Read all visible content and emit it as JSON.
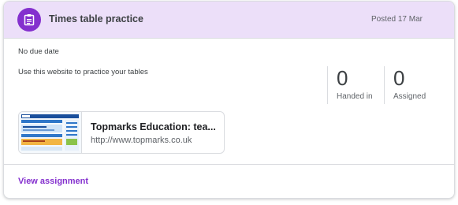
{
  "assignment": {
    "title": "Times table practice",
    "posted": "Posted 17 Mar",
    "due": "No due date",
    "instructions": "Use this website to practice your tables",
    "icon": "assignment-icon",
    "accent_color": "#8430ce",
    "header_color": "#ecdff9"
  },
  "stats": {
    "handed_in": {
      "value": "0",
      "label": "Handed in"
    },
    "assigned": {
      "value": "0",
      "label": "Assigned"
    }
  },
  "attachment": {
    "title": "Topmarks Education: tea...",
    "url": "http://www.topmarks.co.uk",
    "thumbnail": "website-preview-thumbnail"
  },
  "footer": {
    "view_label": "View assignment"
  }
}
